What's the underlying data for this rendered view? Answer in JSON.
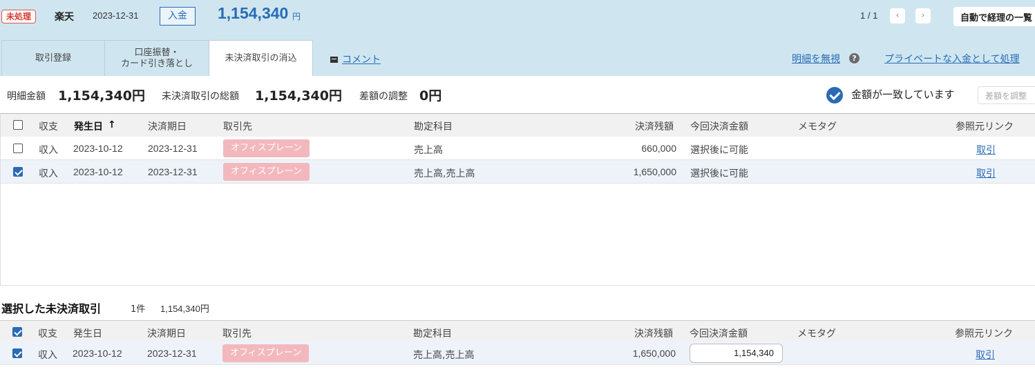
{
  "header": {
    "status": "未処理",
    "bank": "楽天",
    "date": "2023-12-31",
    "type": "入金",
    "amount": "1,154,340",
    "unit": "円",
    "pager": "1 / 1",
    "prev": "‹",
    "next": "›",
    "auto_button": "自動で経理の一覧"
  },
  "tabs": [
    {
      "label": "取引登録"
    },
    {
      "label": "口座振替・\nカード引き落とし"
    },
    {
      "label": "未決済取引の消込"
    }
  ],
  "comment_link": "コメント",
  "ignore_link": "明細を無視",
  "help": "?",
  "private_link": "プライベートな入金として処理",
  "summary": {
    "detail_label": "明細金額",
    "detail_value": "1,154,340円",
    "unsettled_label": "未決済取引の総額",
    "unsettled_value": "1,154,340円",
    "diff_label": "差額の調整",
    "diff_value": "0円",
    "match_text": "金額が一致しています",
    "adjust_button": "差額を調整"
  },
  "columns": {
    "type": "収支",
    "occurred": "発生日",
    "sort_arrow": "↑",
    "due": "決済期日",
    "partner": "取引先",
    "account": "勘定科目",
    "balance": "決済残額",
    "current": "今回決済金額",
    "memo": "メモタグ",
    "ref": "参照元リンク"
  },
  "rows": [
    {
      "checked": false,
      "type": "収入",
      "occurred": "2023-10-12",
      "due": "2023-12-31",
      "partner": "オフィスプレーン",
      "account": "売上高",
      "balance": "660,000",
      "current": "選択後に可能",
      "ref": "取引"
    },
    {
      "checked": true,
      "type": "収入",
      "occurred": "2023-10-12",
      "due": "2023-12-31",
      "partner": "オフィスプレーン",
      "account": "売上高,売上高",
      "balance": "1,650,000",
      "current": "選択後に可能",
      "ref": "取引"
    }
  ],
  "selected": {
    "title": "選択した未決済取引",
    "count": "1件",
    "total": "1,154,340円",
    "rows": [
      {
        "checked": true,
        "type": "収入",
        "occurred": "2023-10-12",
        "due": "2023-12-31",
        "partner": "オフィスプレーン",
        "account": "売上高,売上高",
        "balance": "1,650,000",
        "current_value": "1,154,340",
        "ref": "取引"
      }
    ]
  }
}
